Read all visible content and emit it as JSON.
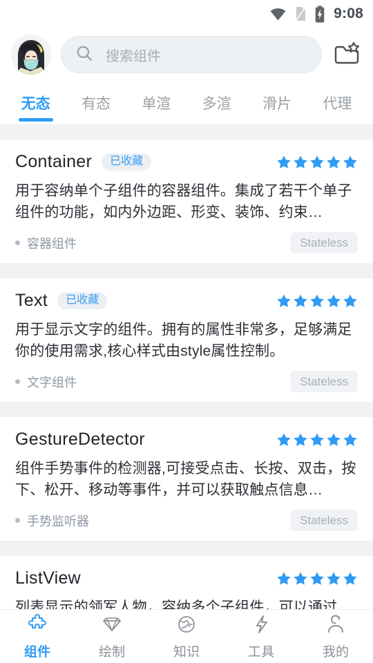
{
  "status_bar": {
    "time": "9:08",
    "icons": [
      "wifi-icon",
      "no-sim-icon",
      "battery-charging-icon"
    ]
  },
  "header": {
    "avatar_name": "user-avatar",
    "search": {
      "placeholder": "搜索组件",
      "value": "",
      "icon": "search-icon"
    },
    "folder_button": {
      "icon": "folder-star-icon",
      "label": ""
    }
  },
  "tabs": {
    "active_index": 0,
    "items": [
      {
        "label": "无态"
      },
      {
        "label": "有态"
      },
      {
        "label": "单渲"
      },
      {
        "label": "多渲"
      },
      {
        "label": "滑片"
      },
      {
        "label": "代理"
      }
    ]
  },
  "components": [
    {
      "name": "Container",
      "favorite_label": "已收藏",
      "favorited": true,
      "rating": 5,
      "description": "用于容纳单个子组件的容器组件。集成了若干个单子组件的功能，如内外边距、形变、装饰、约束…",
      "subtitle": "容器组件",
      "state_tag": "Stateless"
    },
    {
      "name": "Text",
      "favorite_label": "已收藏",
      "favorited": true,
      "rating": 5,
      "description": "用于显示文字的组件。拥有的属性非常多，足够满足你的使用需求,核心样式由style属性控制。",
      "subtitle": "文字组件",
      "state_tag": "Stateless"
    },
    {
      "name": "GestureDetector",
      "favorite_label": "",
      "favorited": false,
      "rating": 5,
      "description": "组件手势事件的检测器,可接受点击、长按、双击，按下、松开、移动等事件，并可以获取触点信息…",
      "subtitle": "手势监听器",
      "state_tag": "Stateless"
    },
    {
      "name": "ListView",
      "favorite_label": "",
      "favorited": false,
      "rating": 5,
      "description": "列表显示的领军人物，容纳多个子组件，可以通过",
      "subtitle": "",
      "state_tag": ""
    }
  ],
  "bottom_nav": {
    "active_index": 0,
    "items": [
      {
        "label": "组件",
        "icon": "puzzle-icon"
      },
      {
        "label": "绘制",
        "icon": "diamond-icon"
      },
      {
        "label": "知识",
        "icon": "globe-icon"
      },
      {
        "label": "工具",
        "icon": "lightning-icon"
      },
      {
        "label": "我的",
        "icon": "person-icon"
      }
    ]
  },
  "colors": {
    "accent": "#2f9bf5",
    "star": "#2f9bf5",
    "page_bg": "#f0f2f4",
    "card_bg": "#ffffff",
    "muted_text": "#9aa0a6"
  }
}
